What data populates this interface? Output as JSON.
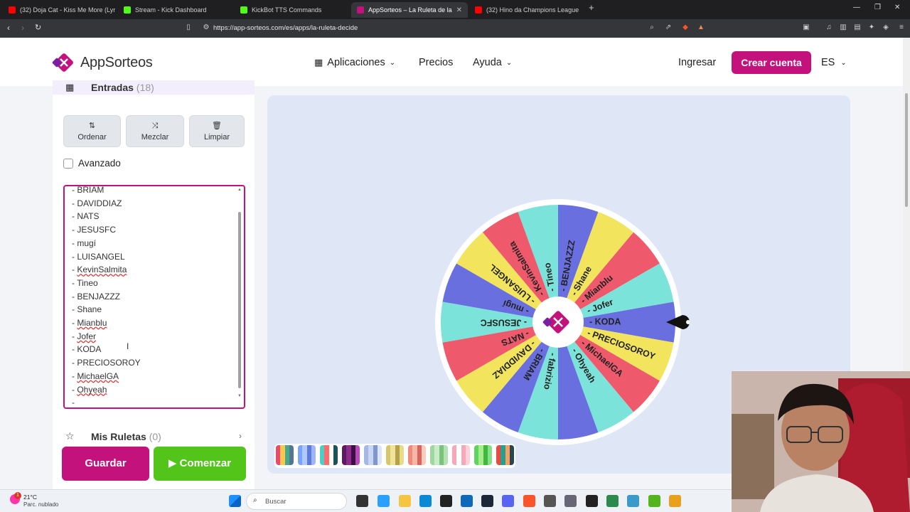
{
  "browser": {
    "tabs": [
      {
        "label": "(32) Doja Cat - Kiss Me More (Lyrics)",
        "color": "#ff0000"
      },
      {
        "label": "Stream - Kick Dashboard",
        "color": "#53fc18"
      },
      {
        "label": "KickBot TTS Commands",
        "color": "#53fc18"
      },
      {
        "label": "AppSorteos – La Ruleta de la Suerte",
        "color": "#c4127d",
        "active": true
      },
      {
        "label": "(32) Hino da Champions League",
        "color": "#ff0000"
      }
    ],
    "new_tab": "+",
    "url": "https://app-sorteos.com/es/apps/la-ruleta-decide"
  },
  "header": {
    "logo_text": "AppSorteos",
    "nav": {
      "apps": "Aplicaciones",
      "pricing": "Precios",
      "help": "Ayuda"
    },
    "login": "Ingresar",
    "signup": "Crear cuenta",
    "lang": "ES"
  },
  "sidebar": {
    "entries_title": "Entradas",
    "entries_count": "(18)",
    "buttons": {
      "sort": "Ordenar",
      "shuffle": "Mezclar",
      "clear": "Limpiar"
    },
    "advanced": "Avanzado",
    "entries": [
      {
        "text": "- BRIAM"
      },
      {
        "text": "- DAVIDDIAZ"
      },
      {
        "text": "- NATS"
      },
      {
        "text": "- JESUSFC"
      },
      {
        "text": "- mugí"
      },
      {
        "text": "- LUISANGEL"
      },
      {
        "prefix": "- ",
        "word": "KevinSalmita",
        "squiggle": true
      },
      {
        "text": "- Tineo"
      },
      {
        "text": "- BENJAZZZ"
      },
      {
        "text": "- Shane"
      },
      {
        "prefix": "- ",
        "word": "Mianblu",
        "squiggle": true
      },
      {
        "prefix": "- ",
        "word": "Jofer",
        "squiggle": true
      },
      {
        "text": "- KODA"
      },
      {
        "text": "- PRECIOSOROY"
      },
      {
        "prefix": "- ",
        "word": "MichaelGA",
        "squiggle": true
      },
      {
        "prefix": "- ",
        "word": "Ohyeah",
        "squiggle": true
      },
      {
        "text": "-"
      }
    ],
    "my_wheels_title": "Mis Ruletas",
    "my_wheels_count": "(0)"
  },
  "actions": {
    "save": "Guardar",
    "start": "▶ Comenzar"
  },
  "wheel": {
    "segments": [
      {
        "label": "- KODA",
        "color": "#6a6fe0"
      },
      {
        "label": "- PRECIOSOROY",
        "color": "#f2e45c"
      },
      {
        "label": "- MichaelGA",
        "color": "#ee5a6c"
      },
      {
        "label": "- Ohyeah",
        "color": "#7be3d9"
      },
      {
        "label": "",
        "color": "#6a6fe0"
      },
      {
        "label": "- fabrizio",
        "color": "#7be3d9"
      },
      {
        "label": "- BRIAM",
        "color": "#6a6fe0"
      },
      {
        "label": "- DAVIDDIAZ",
        "color": "#f2e45c"
      },
      {
        "label": "- NATS",
        "color": "#ee5a6c"
      },
      {
        "label": "- JESUSFC",
        "color": "#7be3d9"
      },
      {
        "label": "- mugí",
        "color": "#6a6fe0"
      },
      {
        "label": "- LUISANGEL",
        "color": "#f2e45c"
      },
      {
        "label": "- KevinSalmita",
        "color": "#ee5a6c"
      },
      {
        "label": "- Tineo",
        "color": "#7be3d9"
      },
      {
        "label": "- BENJAZZZ",
        "color": "#6a6fe0"
      },
      {
        "label": "- Shane",
        "color": "#f2e45c"
      },
      {
        "label": "- Mianblu",
        "color": "#ee5a6c"
      },
      {
        "label": "- Jofer",
        "color": "#7be3d9"
      }
    ]
  },
  "taskbar": {
    "weather_temp": "21°C",
    "weather_desc": "Parc. nublado",
    "search": "Buscar",
    "notification_count": "1"
  },
  "colors": {
    "brand": "#c4127d",
    "start_green": "#52c41a"
  }
}
